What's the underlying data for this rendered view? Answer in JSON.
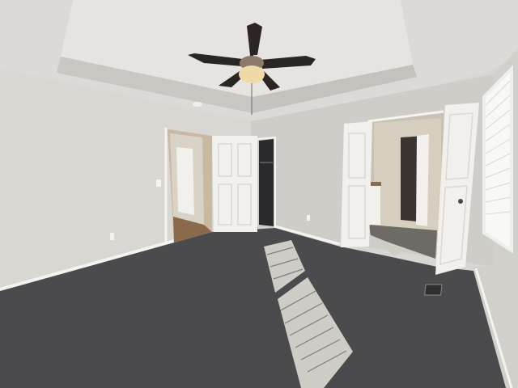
{
  "scene": {
    "kind": "empty bedroom interior photo",
    "elements": [
      "tray-ceiling",
      "ceiling-fan",
      "doorway-hallway",
      "open-door-left",
      "closet-doorway",
      "double-doors-bathroom",
      "window-with-blinds",
      "carpet-floor",
      "sunlight-patches",
      "floor-vent"
    ]
  },
  "colors": {
    "ceiling": "#dcdad6",
    "tray": "#e6e4e0",
    "wall_left": "#d9d7d2",
    "wall_back": "#cfcdc8",
    "wall_right": "#d2d0cb",
    "carpet": "#4b4a4d",
    "carpet_dark": "#3e3d40",
    "door": "#f1f0ec",
    "trim": "#f4f3ef",
    "hardwood": "#8a6a4a",
    "fan_blade": "#2b2623",
    "fan_light": "#f0d9a8",
    "sunlight": "#cfccc6"
  }
}
